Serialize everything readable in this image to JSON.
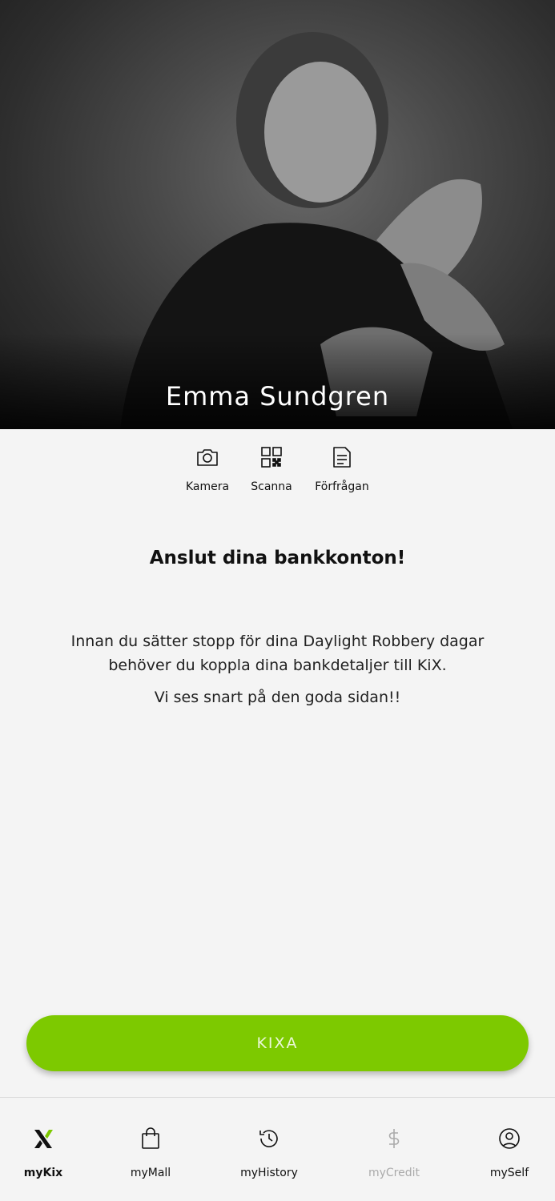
{
  "profile": {
    "name": "Emma Sundgren"
  },
  "actions": [
    {
      "label": "Kamera",
      "icon": "camera-icon"
    },
    {
      "label": "Scanna",
      "icon": "qr-code-icon"
    },
    {
      "label": "Förfrågan",
      "icon": "document-icon"
    }
  ],
  "content": {
    "title": "Anslut dina bankkonton!",
    "paragraph1": "Innan du sätter stopp för dina Daylight Robbery dagar behöver du koppla dina bankdetaljer till KiX.",
    "paragraph2": "Vi ses snart på den goda sidan!!"
  },
  "primary_button": {
    "label": "KIXA"
  },
  "nav": {
    "items": [
      {
        "label": "myKix",
        "icon": "kix-logo-icon",
        "active": true
      },
      {
        "label": "myMall",
        "icon": "shopping-bag-icon"
      },
      {
        "label": "myHistory",
        "icon": "history-icon"
      },
      {
        "label": "myCredit",
        "icon": "dollar-icon",
        "disabled": true
      },
      {
        "label": "mySelf",
        "icon": "user-circle-icon"
      }
    ]
  },
  "colors": {
    "accent": "#7dc900",
    "background": "#f4f4f4",
    "disabled": "#aaaaaa"
  }
}
